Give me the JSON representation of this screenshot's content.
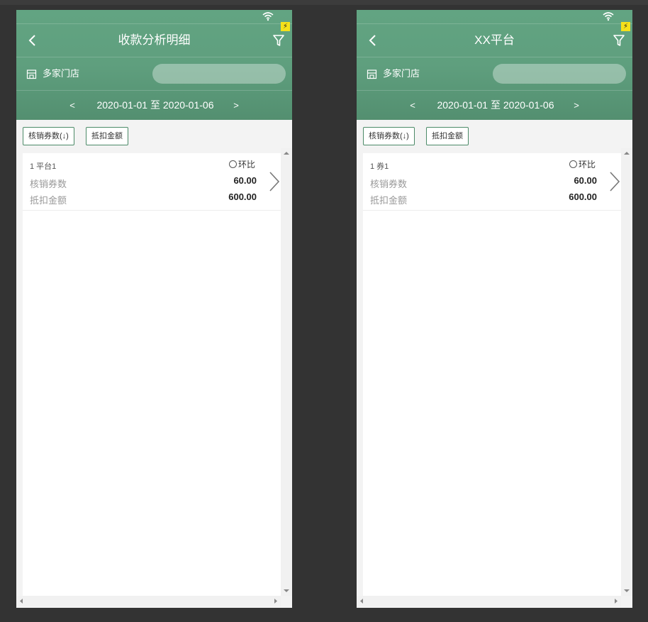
{
  "screens": [
    {
      "title": "收款分析明细",
      "store_label": "多家门店",
      "search_placeholder": "",
      "date": {
        "prev": "<",
        "range": "2020-01-01 至 2020-01-06",
        "next": ">"
      },
      "sort_buttons": [
        "核销券数(↓)",
        "抵扣金额"
      ],
      "items": [
        {
          "name": "1 平台1",
          "compare_label": "环比",
          "metrics": [
            {
              "label": "核销券数",
              "value": "60.00"
            },
            {
              "label": "抵扣金额",
              "value": "600.00"
            }
          ]
        }
      ]
    },
    {
      "title": "XX平台",
      "store_label": "多家门店",
      "search_placeholder": "",
      "date": {
        "prev": "<",
        "range": "2020-01-01 至 2020-01-06",
        "next": ">"
      },
      "sort_buttons": [
        "核销券数(↓)",
        "抵扣金额"
      ],
      "items": [
        {
          "name": "1 券1",
          "compare_label": "环比",
          "metrics": [
            {
              "label": "核销券数",
              "value": "60.00"
            },
            {
              "label": "抵扣金额",
              "value": "600.00"
            }
          ]
        }
      ]
    }
  ],
  "colors": {
    "header_green": "#5f9f7e",
    "header_green_dark": "#538f70",
    "button_border": "#4c8a68",
    "badge_yellow": "#f5e11a",
    "canvas": "#333333"
  },
  "icons": [
    "wifi-icon",
    "bolt-icon",
    "back-icon",
    "filter-icon",
    "store-icon",
    "chevron-right-icon"
  ]
}
